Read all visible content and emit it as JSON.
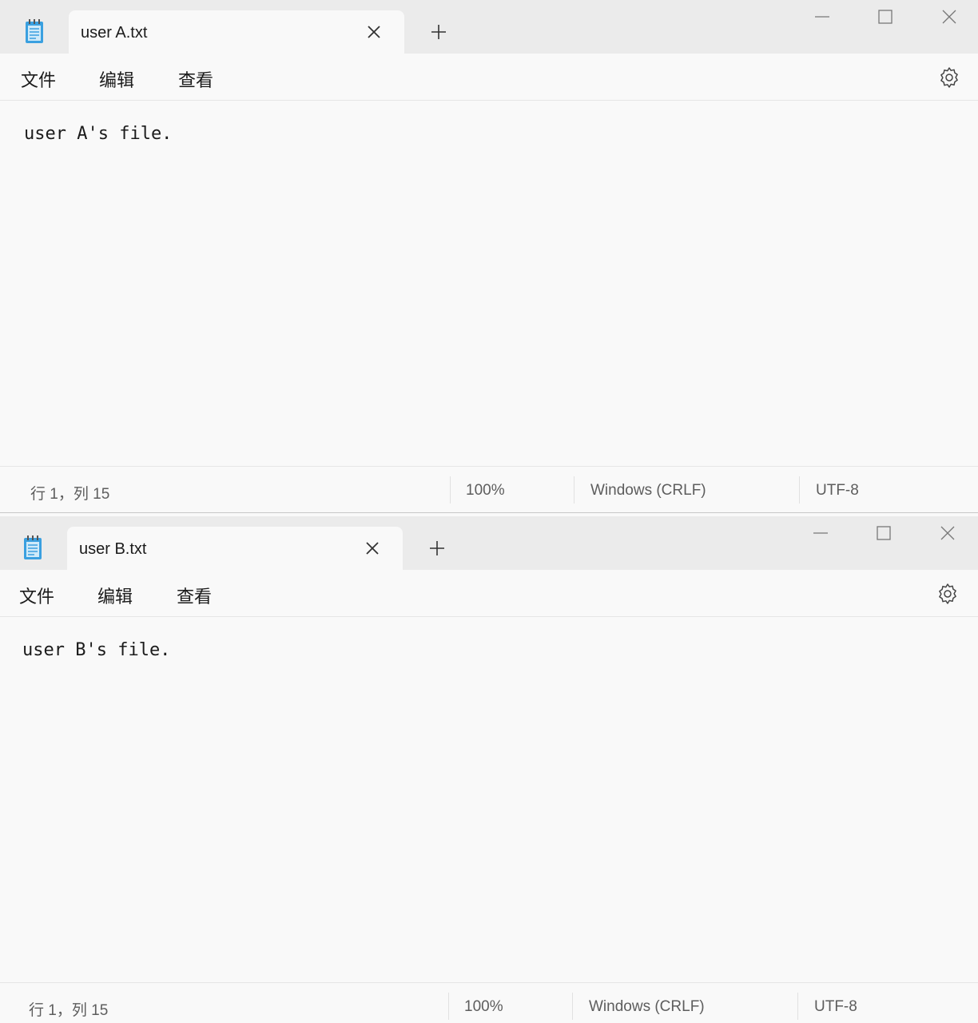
{
  "windows": [
    {
      "tab_title": "user A.txt",
      "menu": [
        "文件",
        "编辑",
        "查看"
      ],
      "content": "user A's file.",
      "status": {
        "position": "行 1，列 15",
        "zoom": "100%",
        "line_ending": "Windows (CRLF)",
        "encoding": "UTF-8"
      }
    },
    {
      "tab_title": "user B.txt",
      "menu": [
        "文件",
        "编辑",
        "查看"
      ],
      "content": "user B's file.",
      "status": {
        "position": "行 1，列 15",
        "zoom": "100%",
        "line_ending": "Windows (CRLF)",
        "encoding": "UTF-8"
      }
    }
  ],
  "icons": {
    "app": "notepad-icon",
    "tab_close": "close-icon",
    "new_tab": "plus-icon",
    "minimize": "minimize-icon",
    "maximize": "maximize-icon",
    "window_close": "close-icon",
    "settings": "gear-icon"
  },
  "colors": {
    "icon_blue": "#3aa0e0",
    "titlebar": "#ebebeb",
    "background": "#f9f9f9"
  }
}
